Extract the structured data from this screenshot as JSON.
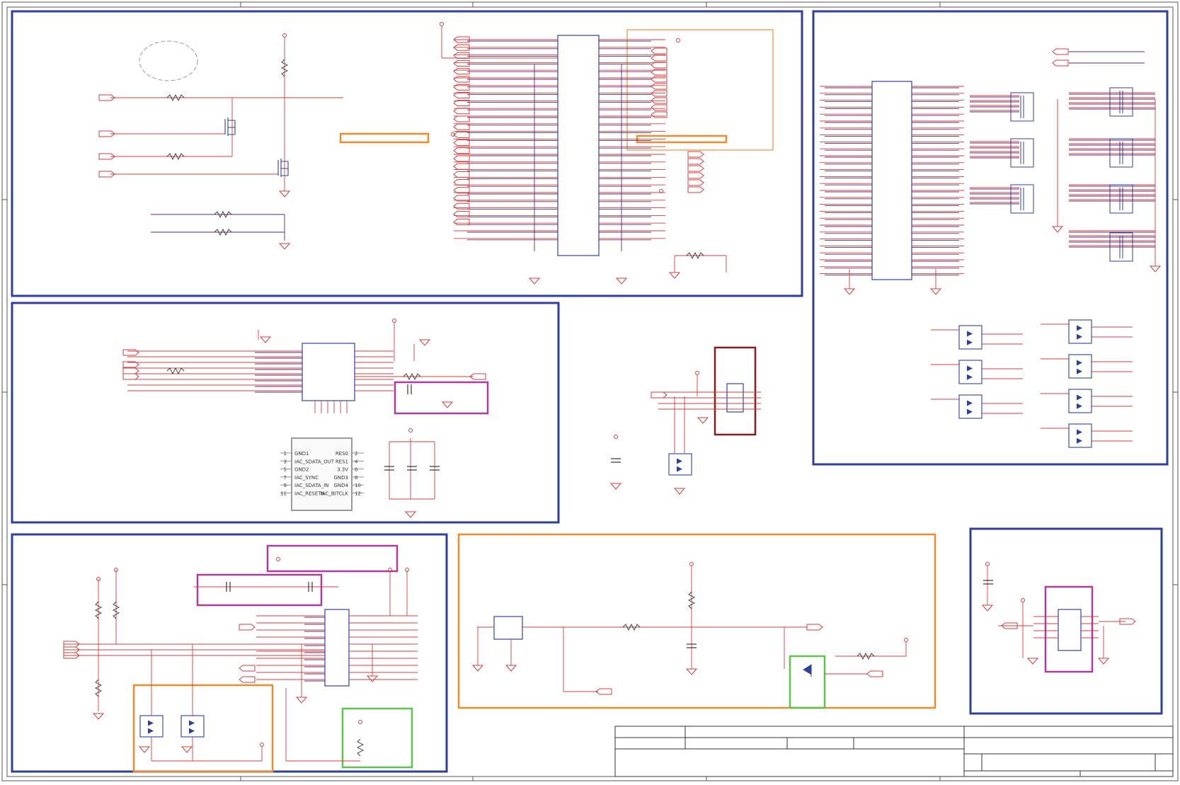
{
  "connector": {
    "left_pins": [
      "GND1",
      "IAC_SDATA_OUT",
      "GND2",
      "IAC_SYNC",
      "IAC_SDATA_IN",
      "IAC_RESETN"
    ],
    "right_pins": [
      "RES0",
      "RES1",
      "3.3V",
      "GND3",
      "GND4",
      "IAC_BITCLK"
    ],
    "left_numbers": [
      "1",
      "3",
      "5",
      "7",
      "9",
      "11"
    ],
    "right_numbers": [
      "2",
      "4",
      "6",
      "8",
      "10",
      "12"
    ]
  }
}
